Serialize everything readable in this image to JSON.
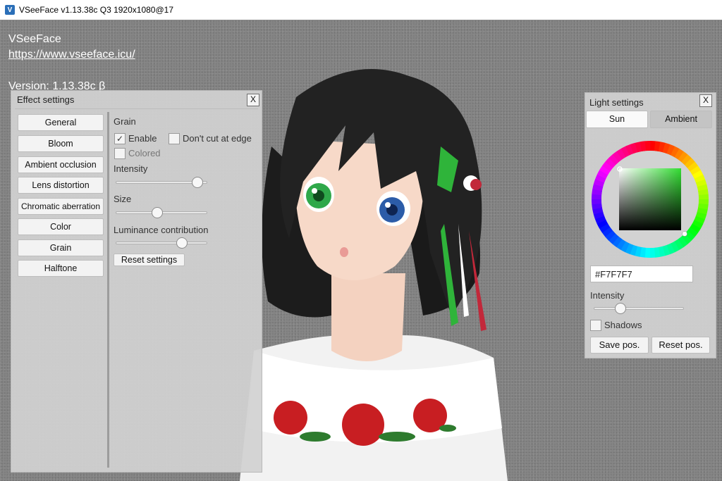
{
  "window": {
    "title": "VSeeFace v1.13.38c Q3 1920x1080@17",
    "icon": "vseeface-app-icon",
    "icon_glyph": "V"
  },
  "overlay": {
    "app_name": "VSeeFace",
    "url": "https://www.vseeface.icu/",
    "version": "Version: 1.13.38c β"
  },
  "effect_settings": {
    "title": "Effect settings",
    "close_label": "X",
    "nav": [
      "General",
      "Bloom",
      "Ambient occlusion",
      "Lens distortion",
      "Chromatic aberration",
      "Color",
      "Grain",
      "Halftone"
    ],
    "section_title": "Grain",
    "enable_label": "Enable",
    "enable_checked": true,
    "dont_cut_label": "Don't cut at edge",
    "dont_cut_checked": false,
    "colored_label": "Colored",
    "colored_checked": false,
    "intensity_label": "Intensity",
    "intensity_value": 0.95,
    "size_label": "Size",
    "size_value": 0.45,
    "luminance_label": "Luminance contribution",
    "luminance_value": 0.75,
    "reset_label": "Reset settings"
  },
  "light_settings": {
    "title": "Light settings",
    "close_label": "X",
    "tab_sun": "Sun",
    "tab_ambient": "Ambient",
    "hex_value": "#F7F7F7",
    "intensity_label": "Intensity",
    "intensity_value": 0.27,
    "shadows_label": "Shadows",
    "shadows_checked": false,
    "save_label": "Save pos.",
    "reset_label": "Reset pos."
  },
  "colors": {
    "selected_hue": "#33dd33",
    "panel_bg": "#d2d2d2",
    "viewport_bg": "#868686"
  },
  "icons": {
    "check": "✓"
  }
}
